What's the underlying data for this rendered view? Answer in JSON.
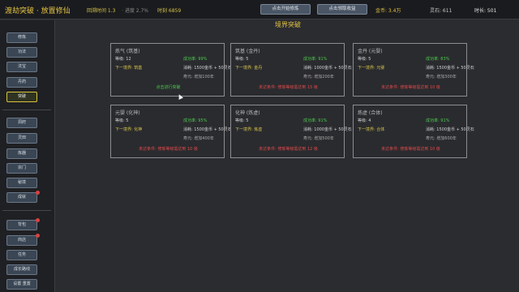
{
  "header": {
    "title": "渡劫突破 · 放置修仙",
    "stat1": "回溯时间 1.3",
    "stat1b": "·  进度 2.7%",
    "stat2": "时刻 6859",
    "button1": "点击开始修炼",
    "button2": "点击领取收益",
    "gold": "金币: 3.4万",
    "stat3": "灵石: 611",
    "stat4": "时长: 501"
  },
  "sidebar": {
    "group1": [
      {
        "label": "修炼"
      },
      {
        "label": "功法"
      },
      {
        "label": "法宝"
      },
      {
        "label": "丹药"
      },
      {
        "label": "突破"
      }
    ],
    "group2": [
      {
        "label": "洞府"
      },
      {
        "label": "灵田"
      },
      {
        "label": "炼器"
      },
      {
        "label": "宗门"
      },
      {
        "label": "秘境"
      },
      {
        "label": "成就"
      }
    ],
    "group3": [
      {
        "label": "背包"
      },
      {
        "label": "商店"
      },
      {
        "label": "任务"
      },
      {
        "label": "成长路线"
      },
      {
        "label": "设置 重置"
      }
    ]
  },
  "main": {
    "title": "境界突破",
    "cards": [
      {
        "name": "炼气 (筑基)",
        "level": "等级: 12",
        "rate": "成功率: 99%",
        "next": "下一境界: 筑基",
        "cost": "消耗: 1500金币 + 50灵石",
        "extra": "寿元: 增加100年",
        "footer": "点击进行突破",
        "ok": true
      },
      {
        "name": "筑基 (金丹)",
        "level": "等级: 5",
        "rate": "成功率: 91%",
        "next": "下一境界: 金丹",
        "cost": "消耗: 1000金币 + 50灵石",
        "extra": "寿元: 增加200年",
        "footer": "未达条件: 修炼等级需达到 15 级",
        "ok": false
      },
      {
        "name": "金丹 (元婴)",
        "level": "等级: 5",
        "rate": "成功率: 83%",
        "next": "下一境界: 元婴",
        "cost": "消耗: 1500金币 + 50灵石",
        "extra": "寿元: 增加300年",
        "footer": "未达条件: 修炼等级需达到 10 级",
        "ok": false
      },
      {
        "name": "元婴 (化神)",
        "level": "等级: 5",
        "rate": "成功率: 95%",
        "next": "下一境界: 化神",
        "cost": "消耗: 1500金币 + 50灵石",
        "extra": "寿元: 增加400年",
        "footer": "未达条件: 修炼等级需达到 10 级",
        "ok": false
      },
      {
        "name": "化神 (炼虚)",
        "level": "等级: 5",
        "rate": "成功率: 91%",
        "next": "下一境界: 炼虚",
        "cost": "消耗: 1000金币 + 50灵石",
        "extra": "寿元: 增加500年",
        "footer": "未达条件: 修炼等级需达到 12 级",
        "ok": false
      },
      {
        "name": "炼虚 (合体)",
        "level": "等级: 4",
        "rate": "成功率: 91%",
        "next": "下一境界: 合体",
        "cost": "消耗: 1500金币 + 50灵石",
        "extra": "寿元: 增加600年",
        "footer": "未达条件: 修炼等级需达到 10 级",
        "ok": false
      }
    ]
  }
}
